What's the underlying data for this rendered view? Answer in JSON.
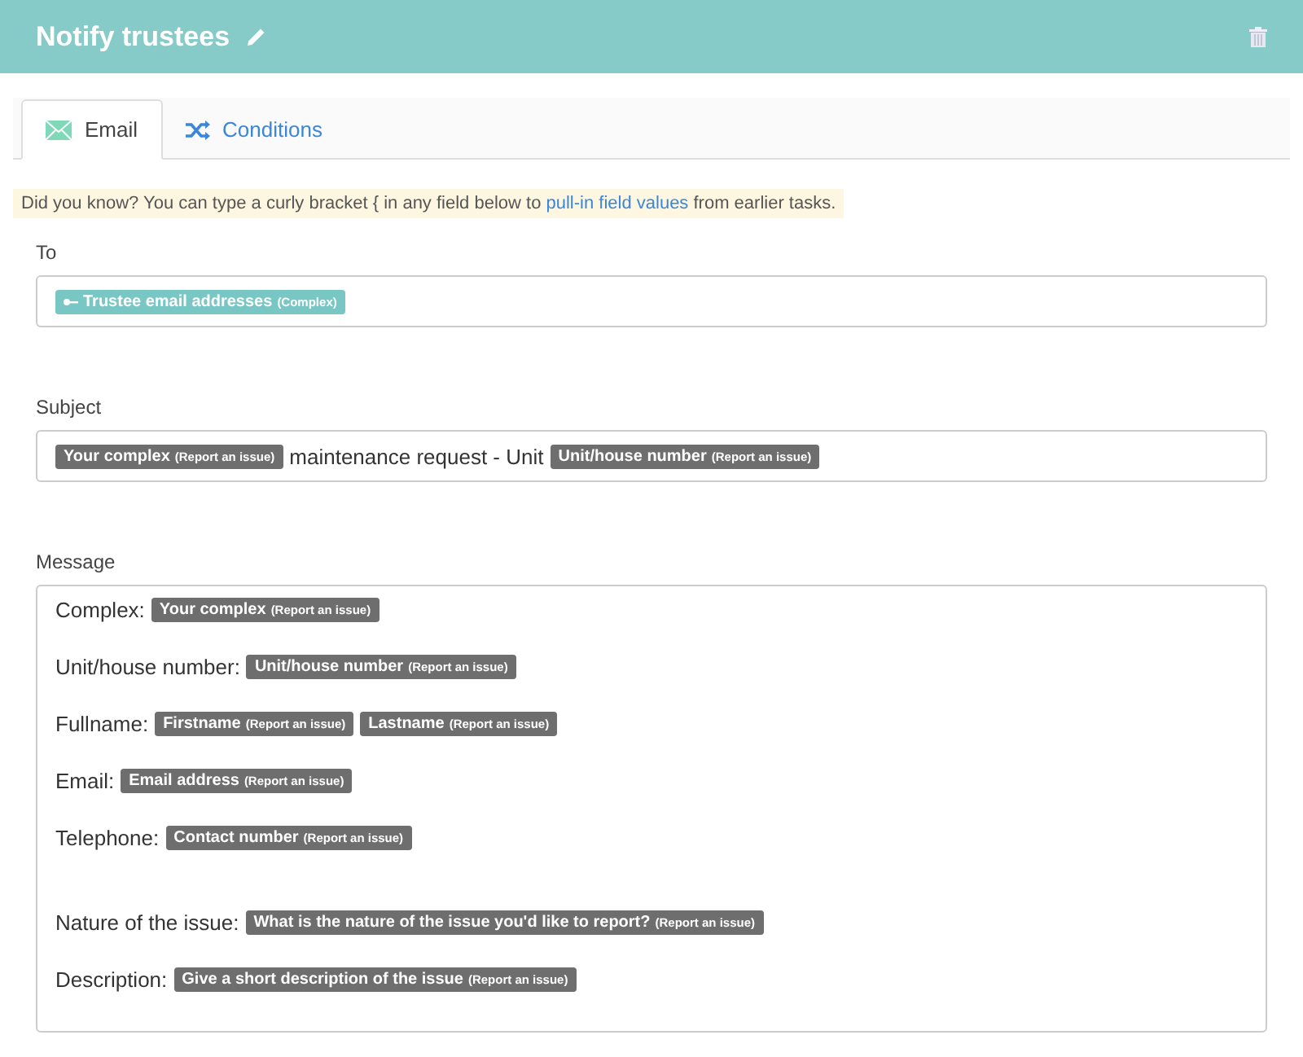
{
  "header": {
    "title": "Notify trustees"
  },
  "tabs": [
    {
      "label": "Email",
      "kind": "email",
      "selected": true
    },
    {
      "label": "Conditions",
      "kind": "conditions",
      "selected": false
    }
  ],
  "tip": {
    "before": "Did you know? You can type a curly bracket { in any field below to ",
    "link": "pull-in field values",
    "after": " from earlier tasks."
  },
  "to": {
    "label": "To",
    "parts": [
      {
        "kind": "group",
        "name": "Trustee email addresses",
        "source": "(Complex)"
      }
    ]
  },
  "subject": {
    "label": "Subject",
    "parts": [
      {
        "kind": "field",
        "name": "Your complex",
        "source": "(Report an issue)"
      },
      {
        "kind": "text",
        "text": "maintenance request - Unit"
      },
      {
        "kind": "field",
        "name": "Unit/house number",
        "source": "(Report an issue)"
      }
    ]
  },
  "message": {
    "label": "Message",
    "paragraphs": [
      {
        "lines": [
          {
            "label": "Complex:",
            "tokens": [
              {
                "name": "Your complex",
                "source": "(Report an issue)"
              }
            ]
          },
          {
            "label": "Unit/house number:",
            "tokens": [
              {
                "name": "Unit/house number",
                "source": "(Report an issue)"
              }
            ]
          },
          {
            "label": "Fullname:",
            "tokens": [
              {
                "name": "Firstname",
                "source": "(Report an issue)"
              },
              {
                "name": "Lastname",
                "source": "(Report an issue)"
              }
            ]
          },
          {
            "label": "Email:",
            "tokens": [
              {
                "name": "Email address",
                "source": "(Report an issue)"
              }
            ]
          },
          {
            "label": "Telephone:",
            "tokens": [
              {
                "name": "Contact number",
                "source": "(Report an issue)"
              }
            ]
          }
        ]
      },
      {
        "lines": [
          {
            "label": "Nature of the issue:",
            "tokens": [
              {
                "name": "What is the nature of the issue you'd like to report?",
                "source": "(Report an issue)"
              }
            ]
          },
          {
            "label": "Description:",
            "tokens": [
              {
                "name": "Give a short description of the issue",
                "source": "(Report an issue)"
              }
            ]
          }
        ]
      }
    ]
  }
}
